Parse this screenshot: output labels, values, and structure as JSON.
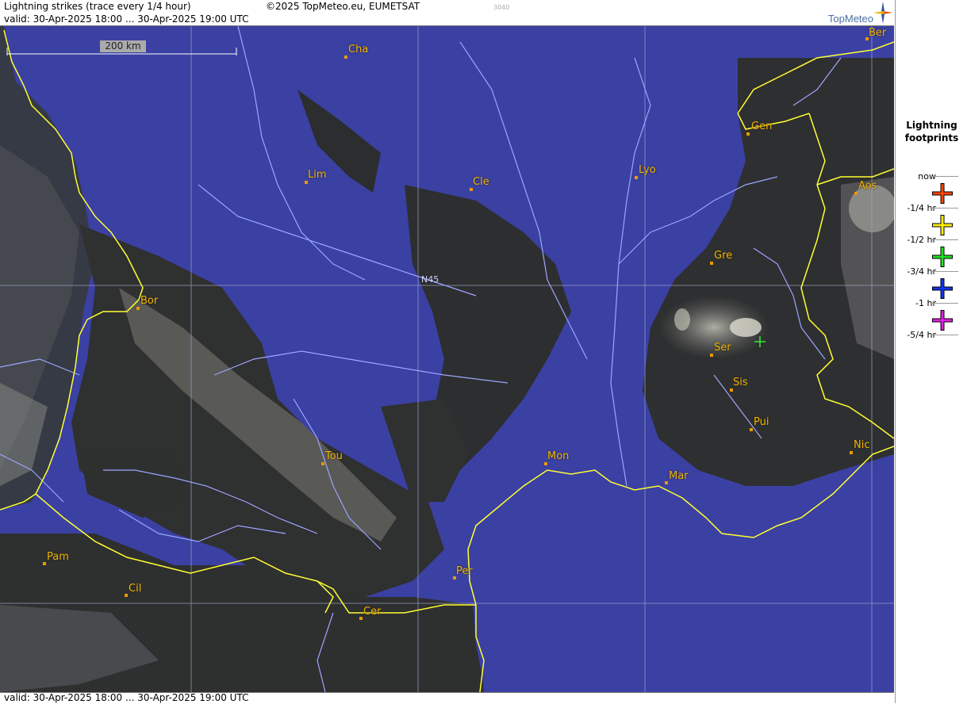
{
  "header": {
    "title": "Lightning strikes (trace every 1/4 hour)",
    "copyright": "©2025 TopMeteo.eu, EUMETSAT",
    "code": "3040",
    "valid": "valid:  30-Apr-2025 18:00 ... 30-Apr-2025 19:00 UTC",
    "brand": "TopMeteo"
  },
  "footer": {
    "valid": "valid:  30-Apr-2025 18:00 ... 30-Apr-2025 19:00 UTC"
  },
  "map": {
    "scale_label": "200 km",
    "lat_label": "N45",
    "cities": [
      {
        "id": "cha",
        "label": "Cha"
      },
      {
        "id": "ber",
        "label": "Ber"
      },
      {
        "id": "gen",
        "label": "Gen"
      },
      {
        "id": "lim",
        "label": "Lim"
      },
      {
        "id": "cle",
        "label": "Cle"
      },
      {
        "id": "lyo",
        "label": "Lyo"
      },
      {
        "id": "aos",
        "label": "Aos"
      },
      {
        "id": "gre",
        "label": "Gre"
      },
      {
        "id": "bor",
        "label": "Bor"
      },
      {
        "id": "ser",
        "label": "Ser"
      },
      {
        "id": "sis",
        "label": "Sis"
      },
      {
        "id": "pui",
        "label": "Pui"
      },
      {
        "id": "tou",
        "label": "Tou"
      },
      {
        "id": "mon",
        "label": "Mon"
      },
      {
        "id": "mar",
        "label": "Mar"
      },
      {
        "id": "nic",
        "label": "Nic"
      },
      {
        "id": "pam",
        "label": "Pam"
      },
      {
        "id": "cil",
        "label": "Cil"
      },
      {
        "id": "per",
        "label": "Per"
      },
      {
        "id": "cer",
        "label": "Cer"
      }
    ],
    "strike_color": "#33ee33"
  },
  "legend": {
    "title_line1": "Lightning",
    "title_line2": "footprints",
    "items": [
      {
        "label": "now",
        "color": "#ff4400"
      },
      {
        "label": "-1/4 hr",
        "color": "#ffee00"
      },
      {
        "label": "-1/2 hr",
        "color": "#22dd22"
      },
      {
        "label": "-3/4 hr",
        "color": "#1133ee"
      },
      {
        "label": "-1 hr",
        "color": "#dd22dd"
      },
      {
        "label": "-5/4 hr",
        "color": ""
      }
    ]
  },
  "colors": {
    "sea_land": "#3a3fa0",
    "border": "#ffff33",
    "river": "#9aa6ff",
    "city": "#f0b400"
  }
}
